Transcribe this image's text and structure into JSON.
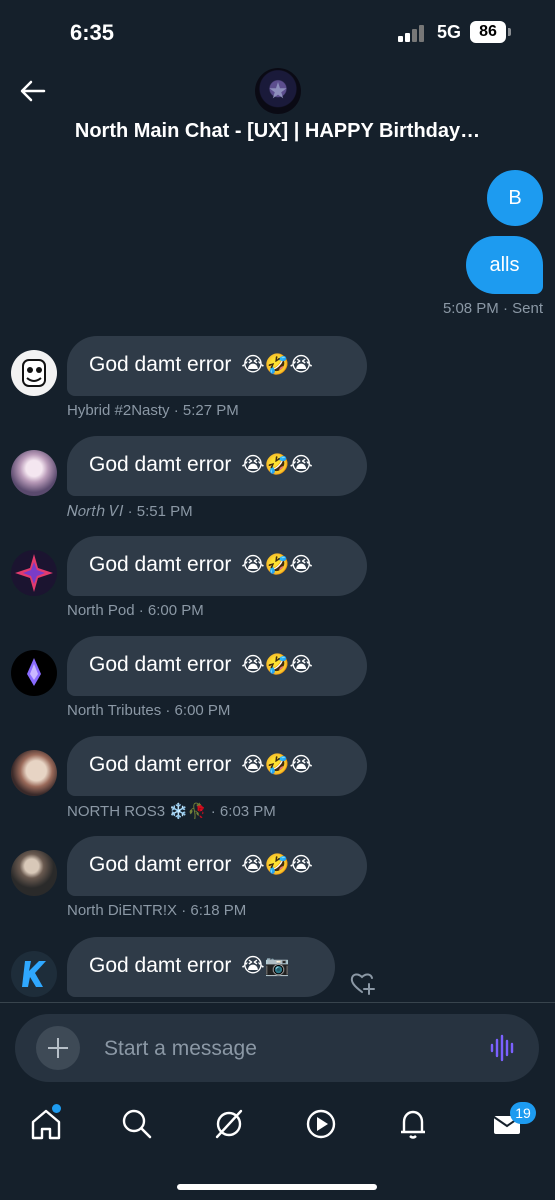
{
  "status_bar": {
    "time": "6:35",
    "network": "5G",
    "battery": "86"
  },
  "header": {
    "title": "North Main Chat - [UX] | HAPPY Birthday…"
  },
  "my_messages": [
    {
      "text": "B"
    },
    {
      "text": "alls"
    }
  ],
  "sent_meta": "5:08 PM · Sent",
  "messages": [
    {
      "sender": "Hybrid #2Nasty",
      "time": "· 5:27 PM",
      "text": "God damt error",
      "emojis": "😭🤣😭"
    },
    {
      "sender": "𝑁𝑜𝑟𝑡ℎ 𝑉𝐼",
      "time": "· 5:51 PM",
      "text": "God damt error",
      "emojis": "😭🤣😭"
    },
    {
      "sender": "North Pod",
      "time": "· 6:00 PM",
      "text": "God damt error",
      "emojis": "😭🤣😭"
    },
    {
      "sender": "North Tributes",
      "time": "· 6:00 PM",
      "text": "God damt error",
      "emojis": "😭🤣😭"
    },
    {
      "sender": "NORTH ROS3 ❄️🥀",
      "time": "· 6:03 PM",
      "text": "God damt error",
      "emojis": "😭🤣😭"
    },
    {
      "sender": "North DiENTR!X",
      "time": "· 6:18 PM",
      "text": "God damt error",
      "emojis": "😭🤣😭"
    },
    {
      "sender": "",
      "time": "",
      "text": "God damt error",
      "emojis": "😭📷"
    }
  ],
  "composer": {
    "placeholder": "Start a message"
  },
  "tabs": [
    {
      "icon": "home-icon"
    },
    {
      "icon": "search-icon"
    },
    {
      "icon": "grok-icon"
    },
    {
      "icon": "play-icon"
    },
    {
      "icon": "bell-icon"
    },
    {
      "icon": "mail-icon"
    }
  ],
  "mail_badge": "19",
  "colors": {
    "accent": "#1d9bf0",
    "background": "#15202b",
    "bubble": "#2f3b48"
  }
}
